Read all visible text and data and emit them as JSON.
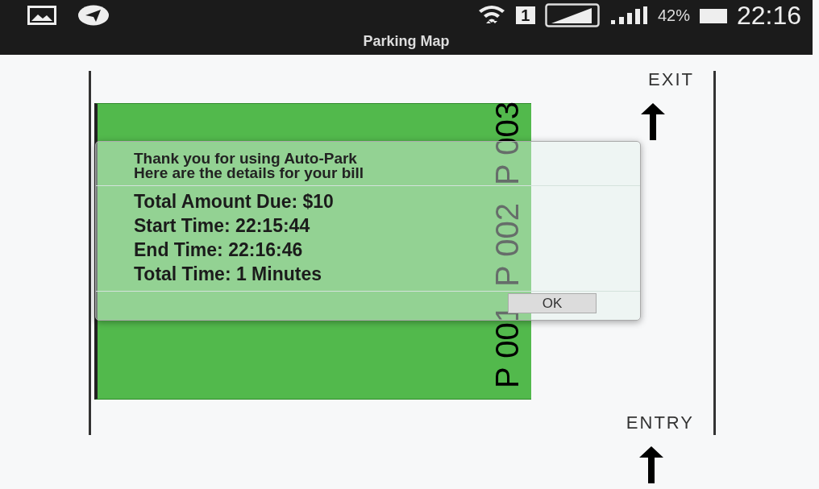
{
  "status_bar": {
    "sim": "1",
    "battery": "42%",
    "time": "22:16"
  },
  "title": "Parking Map",
  "map": {
    "exit_label": "EXIT",
    "entry_label": "ENTRY",
    "slots": [
      {
        "label": "P 001"
      },
      {
        "label": "P 002"
      },
      {
        "label": "P 003"
      }
    ]
  },
  "dialog": {
    "message": [
      "Thank you for using Auto-Park",
      "Here are the details for your bill"
    ],
    "details": [
      "Total Amount Due: $10",
      "Start Time: 22:15:44",
      "End Time: 22:16:46",
      "Total Time: 1 Minutes"
    ],
    "buttons": [
      "OK"
    ]
  }
}
